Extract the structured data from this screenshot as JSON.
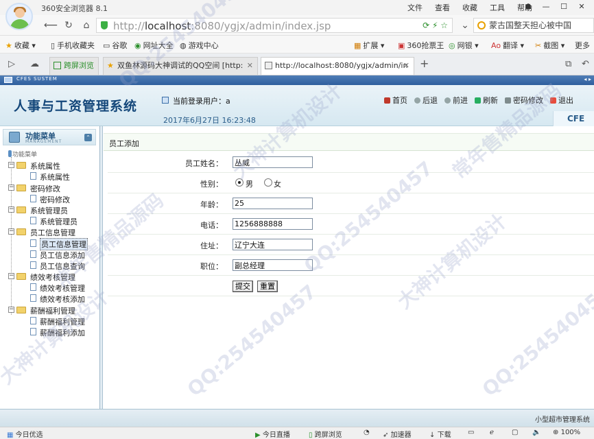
{
  "browser": {
    "app_title": "360安全浏览器 8.1",
    "menus": [
      "文件",
      "查看",
      "收藏",
      "工具",
      "帮助"
    ],
    "url_prefix": "http://",
    "url_host": "localhost",
    "url_rest": ":8080/ygjx/admin/index.jsp",
    "search_text": "蒙古国整天担心被中国",
    "bookmarks": [
      "收藏",
      "手机收藏夹",
      "谷歌",
      "网址大全",
      "游戏中心",
      "扩展",
      "360抢票王",
      "网银",
      "翻译",
      "截图",
      "更多"
    ],
    "tabs": [
      {
        "label": "跨屏浏览"
      },
      {
        "label": "双鱼林源码大神调试的QQ空间 [http:"
      },
      {
        "label": "http://localhost:8080/ygjx/admin/in"
      }
    ]
  },
  "app": {
    "sys_label": "CFES SUSTEM",
    "logo": "人事与工资管理系统",
    "login_label": "当前登录用户：a",
    "date": "2017年6月27日  16:23:48",
    "topnav": [
      "首页",
      "后退",
      "前进",
      "刷新",
      "密码修改",
      "退出"
    ],
    "corner": "CFE",
    "sidebar": {
      "title": "功能菜单",
      "subtitle": "MANAGEMENT",
      "root": "功能菜单",
      "groups": [
        {
          "label": "系统属性",
          "items": [
            "系统属性"
          ]
        },
        {
          "label": "密码修改",
          "items": [
            "密码修改"
          ]
        },
        {
          "label": "系统管理员",
          "items": [
            "系统管理员"
          ]
        },
        {
          "label": "员工信息管理",
          "items": [
            "员工信息管理",
            "员工信息添加",
            "员工信息查询"
          ]
        },
        {
          "label": "绩效考核管理",
          "items": [
            "绩效考核管理",
            "绩效考核添加"
          ]
        },
        {
          "label": "薪酬福利管理",
          "items": [
            "薪酬福利管理",
            "薪酬福利添加"
          ]
        }
      ]
    },
    "content": {
      "title": "员工添加",
      "name_label": "员工姓名：",
      "name_value": "丛威",
      "gender_label": "性别：",
      "gender_male": "男",
      "gender_female": "女",
      "gender_selected": "男",
      "age_label": "年龄：",
      "age_value": "25",
      "phone_label": "电话：",
      "phone_value": "1256888888",
      "address_label": "住址：",
      "address_value": "辽宁大连",
      "position_label": "职位：",
      "position_value": "副总经理",
      "submit_label": "提交",
      "reset_label": "重置"
    },
    "footer": "小型超市管理系统"
  },
  "statusbar": {
    "left": "今日优选",
    "items": [
      "今日直播",
      "跨屏浏览",
      "加速器",
      "下载"
    ],
    "zoom": "100%"
  },
  "watermarks": [
    "QQ:254540457",
    "大神计算机设计",
    "常年售精品源码"
  ]
}
